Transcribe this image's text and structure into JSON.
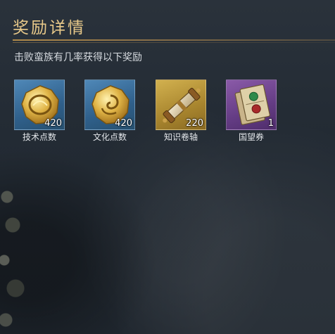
{
  "dialog": {
    "title": "奖励详情",
    "subtitle": "击败蛮族有几率获得以下奖励"
  },
  "rewards": [
    {
      "name": "技术点数",
      "count": "420",
      "rarity": "blue",
      "icon": "gold-coin-icon"
    },
    {
      "name": "文化点数",
      "count": "420",
      "rarity": "blue",
      "icon": "gold-coin-swirl-icon"
    },
    {
      "name": "知识卷轴",
      "count": "220",
      "rarity": "gold",
      "icon": "scroll-icon"
    },
    {
      "name": "国望券",
      "count": "1",
      "rarity": "purple",
      "icon": "ticket-icon"
    }
  ],
  "colors": {
    "title": "#e8c98a",
    "rarity_blue": "#3f72a0",
    "rarity_gold": "#c0a040",
    "rarity_purple": "#74489a"
  }
}
